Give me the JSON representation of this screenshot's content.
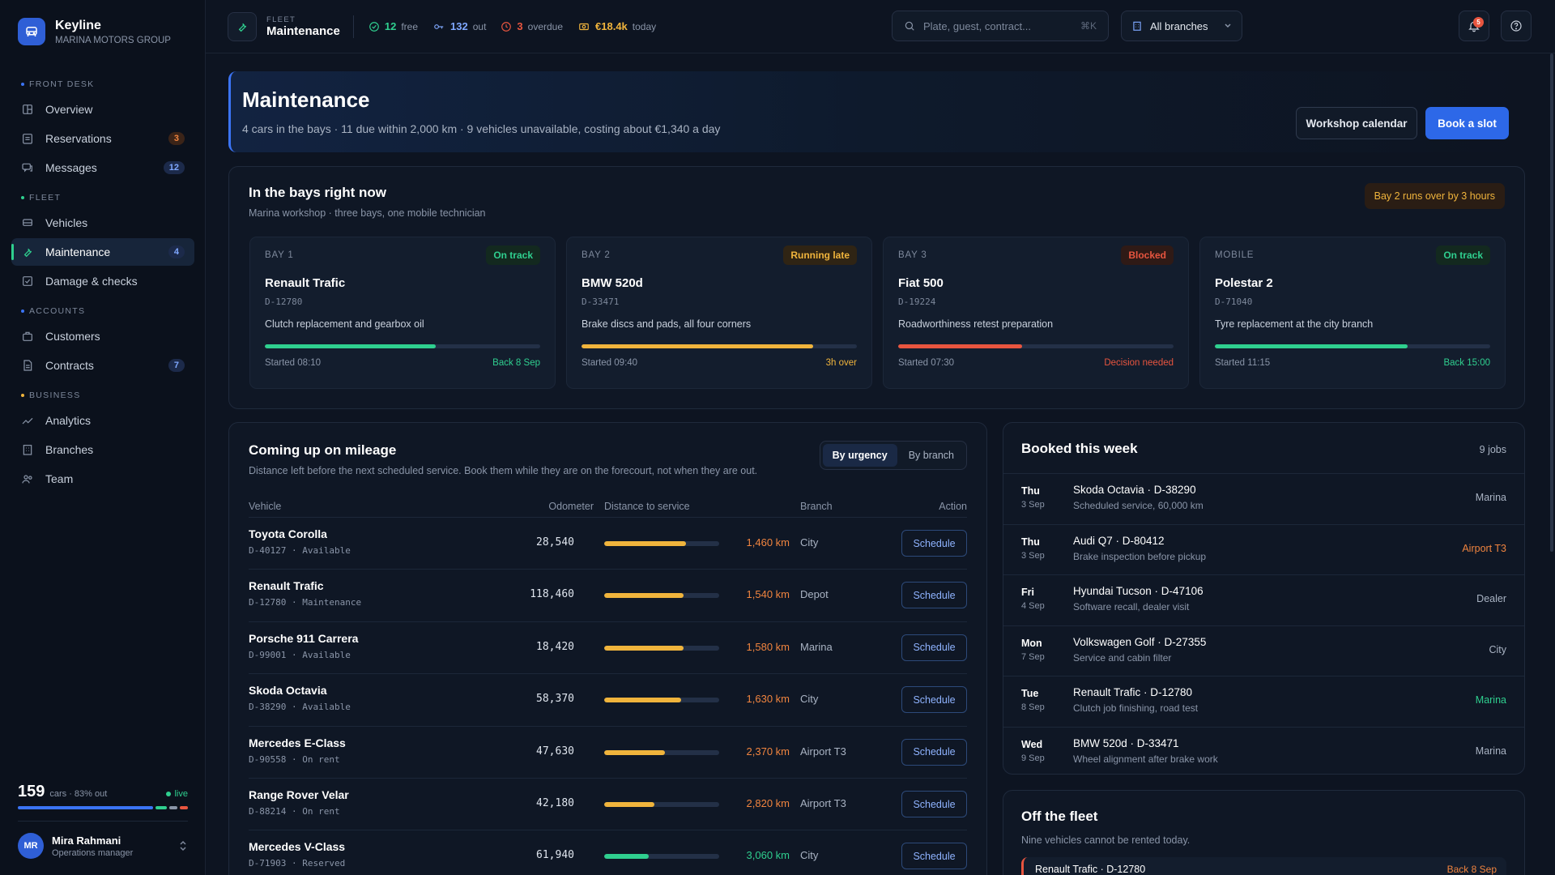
{
  "brand": {
    "name": "Keyline",
    "org": "MARINA MOTORS GROUP"
  },
  "nav": {
    "front_desk": "FRONT DESK",
    "overview": "Overview",
    "reservations": "Reservations",
    "reservations_count": "3",
    "messages": "Messages",
    "messages_count": "12",
    "fleet": "FLEET",
    "vehicles": "Vehicles",
    "maintenance": "Maintenance",
    "maintenance_count": "4",
    "damage": "Damage & checks",
    "accounts": "ACCOUNTS",
    "customers": "Customers",
    "contracts": "Contracts",
    "contracts_count": "7",
    "business": "BUSINESS",
    "analytics": "Analytics",
    "branches": "Branches",
    "team": "Team"
  },
  "footer": {
    "cars": "159",
    "cars_sub": "cars · 83% out",
    "live": "live",
    "user_initials": "MR",
    "user_name": "Mira Rahmani",
    "user_role": "Operations manager",
    "fleet_split": [
      0.83,
      0.07,
      0.05,
      0.05
    ]
  },
  "topbar": {
    "kicker": "FLEET",
    "title": "Maintenance",
    "free_n": "12",
    "free": "free",
    "out_n": "132",
    "out": "out",
    "overdue_n": "3",
    "overdue": "overdue",
    "revenue": "€18.4k",
    "today": "today",
    "search_placeholder": "Plate, guest, contract...",
    "search_kbd": "⌘K",
    "branch": "All branches",
    "notif_count": "5"
  },
  "hero": {
    "title": "Maintenance",
    "subtitle": "4 cars in the bays · 11 due within 2,000 km · 9 vehicles unavailable, costing about €1,340 a day",
    "btn_calendar": "Workshop calendar",
    "btn_book": "Book a slot"
  },
  "bays": {
    "title": "In the bays right now",
    "subtitle": "Marina workshop · three bays, one mobile technician",
    "alert": "Bay 2 runs over by 3 hours",
    "items": [
      {
        "bay": "BAY 1",
        "status": "On track",
        "car": "Renault Trafic",
        "plate": "D-12780",
        "job": "Clutch replacement and gearbox oil",
        "progress": 0.62,
        "started": "Started 08:10",
        "eta": "Back 8 Sep",
        "color": "#2fcf8f"
      },
      {
        "bay": "BAY 2",
        "status": "Running late",
        "car": "BMW 520d",
        "plate": "D-33471",
        "job": "Brake discs and pads, all four corners",
        "progress": 0.84,
        "started": "Started 09:40",
        "eta": "3h over",
        "color": "#f0b43c"
      },
      {
        "bay": "BAY 3",
        "status": "Blocked",
        "car": "Fiat 500",
        "plate": "D-19224",
        "job": "Roadworthiness retest preparation",
        "progress": 0.45,
        "started": "Started 07:30",
        "eta": "Decision needed",
        "color": "#e8553f"
      },
      {
        "bay": "MOBILE",
        "status": "On track",
        "car": "Polestar 2",
        "plate": "D-71040",
        "job": "Tyre replacement at the city branch",
        "progress": 0.7,
        "started": "Started 11:15",
        "eta": "Back 15:00",
        "color": "#2fcf8f"
      }
    ]
  },
  "mileage": {
    "title": "Coming up on mileage",
    "subtitle": "Distance left before the next scheduled service. Book them while they are on the forecourt, not when they are out.",
    "tab1": "By urgency",
    "tab2": "By branch",
    "cols": {
      "vehicle": "Vehicle",
      "odometer": "Odometer",
      "distance": "Distance to service",
      "branch": "Branch",
      "action": "Action"
    },
    "action_label": "Schedule",
    "rows": [
      {
        "vehicle": "Toyota Corolla",
        "sub": "D-40127 · Available",
        "odo": "28,540",
        "km": "1,460 km",
        "fill": 0.71,
        "branch": "City",
        "color": "#f0b43c",
        "kmcolor": "#f0843f"
      },
      {
        "vehicle": "Renault Trafic",
        "sub": "D-12780 · Maintenance",
        "odo": "118,460",
        "km": "1,540 km",
        "fill": 0.69,
        "branch": "Depot",
        "color": "#f0b43c",
        "kmcolor": "#f0843f"
      },
      {
        "vehicle": "Porsche 911 Carrera",
        "sub": "D-99001 · Available",
        "odo": "18,420",
        "km": "1,580 km",
        "fill": 0.69,
        "branch": "Marina",
        "color": "#f0b43c",
        "kmcolor": "#f0843f"
      },
      {
        "vehicle": "Skoda Octavia",
        "sub": "D-38290 · Available",
        "odo": "58,370",
        "km": "1,630 km",
        "fill": 0.67,
        "branch": "City",
        "color": "#f0b43c",
        "kmcolor": "#f0843f"
      },
      {
        "vehicle": "Mercedes E-Class",
        "sub": "D-90558 · On rent",
        "odo": "47,630",
        "km": "2,370 km",
        "fill": 0.53,
        "branch": "Airport T3",
        "color": "#f0b43c",
        "kmcolor": "#f0843f"
      },
      {
        "vehicle": "Range Rover Velar",
        "sub": "D-88214 · On rent",
        "odo": "42,180",
        "km": "2,820 km",
        "fill": 0.44,
        "branch": "Airport T3",
        "color": "#f0b43c",
        "kmcolor": "#f0843f"
      },
      {
        "vehicle": "Mercedes V-Class",
        "sub": "D-71903 · Reserved",
        "odo": "61,940",
        "km": "3,060 km",
        "fill": 0.39,
        "branch": "City",
        "color": "#2fcf8f",
        "kmcolor": "#2fcf8f"
      }
    ]
  },
  "week": {
    "title": "Booked this week",
    "count": "9 jobs",
    "items": [
      {
        "day": "Thu",
        "date": "3 Sep",
        "car": "Skoda Octavia · D-38290",
        "job": "Scheduled service, 60,000 km",
        "branch": "Marina",
        "color": "#a9b3c3"
      },
      {
        "day": "Thu",
        "date": "3 Sep",
        "car": "Audi Q7 · D-80412",
        "job": "Brake inspection before pickup",
        "branch": "Airport T3",
        "color": "#f0843f"
      },
      {
        "day": "Fri",
        "date": "4 Sep",
        "car": "Hyundai Tucson · D-47106",
        "job": "Software recall, dealer visit",
        "branch": "Dealer",
        "color": "#a9b3c3"
      },
      {
        "day": "Mon",
        "date": "7 Sep",
        "car": "Volkswagen Golf · D-27355",
        "job": "Service and cabin filter",
        "branch": "City",
        "color": "#a9b3c3"
      },
      {
        "day": "Tue",
        "date": "8 Sep",
        "car": "Renault Trafic · D-12780",
        "job": "Clutch job finishing, road test",
        "branch": "Marina",
        "color": "#2fcf8f"
      },
      {
        "day": "Wed",
        "date": "9 Sep",
        "car": "BMW 520d · D-33471",
        "job": "Wheel alignment after brake work",
        "branch": "Marina",
        "color": "#a9b3c3"
      }
    ]
  },
  "offfleet": {
    "title": "Off the fleet",
    "subtitle": "Nine vehicles cannot be rented today.",
    "first_car": "Renault Trafic · D-12780",
    "first_eta": "Back 8 Sep"
  }
}
